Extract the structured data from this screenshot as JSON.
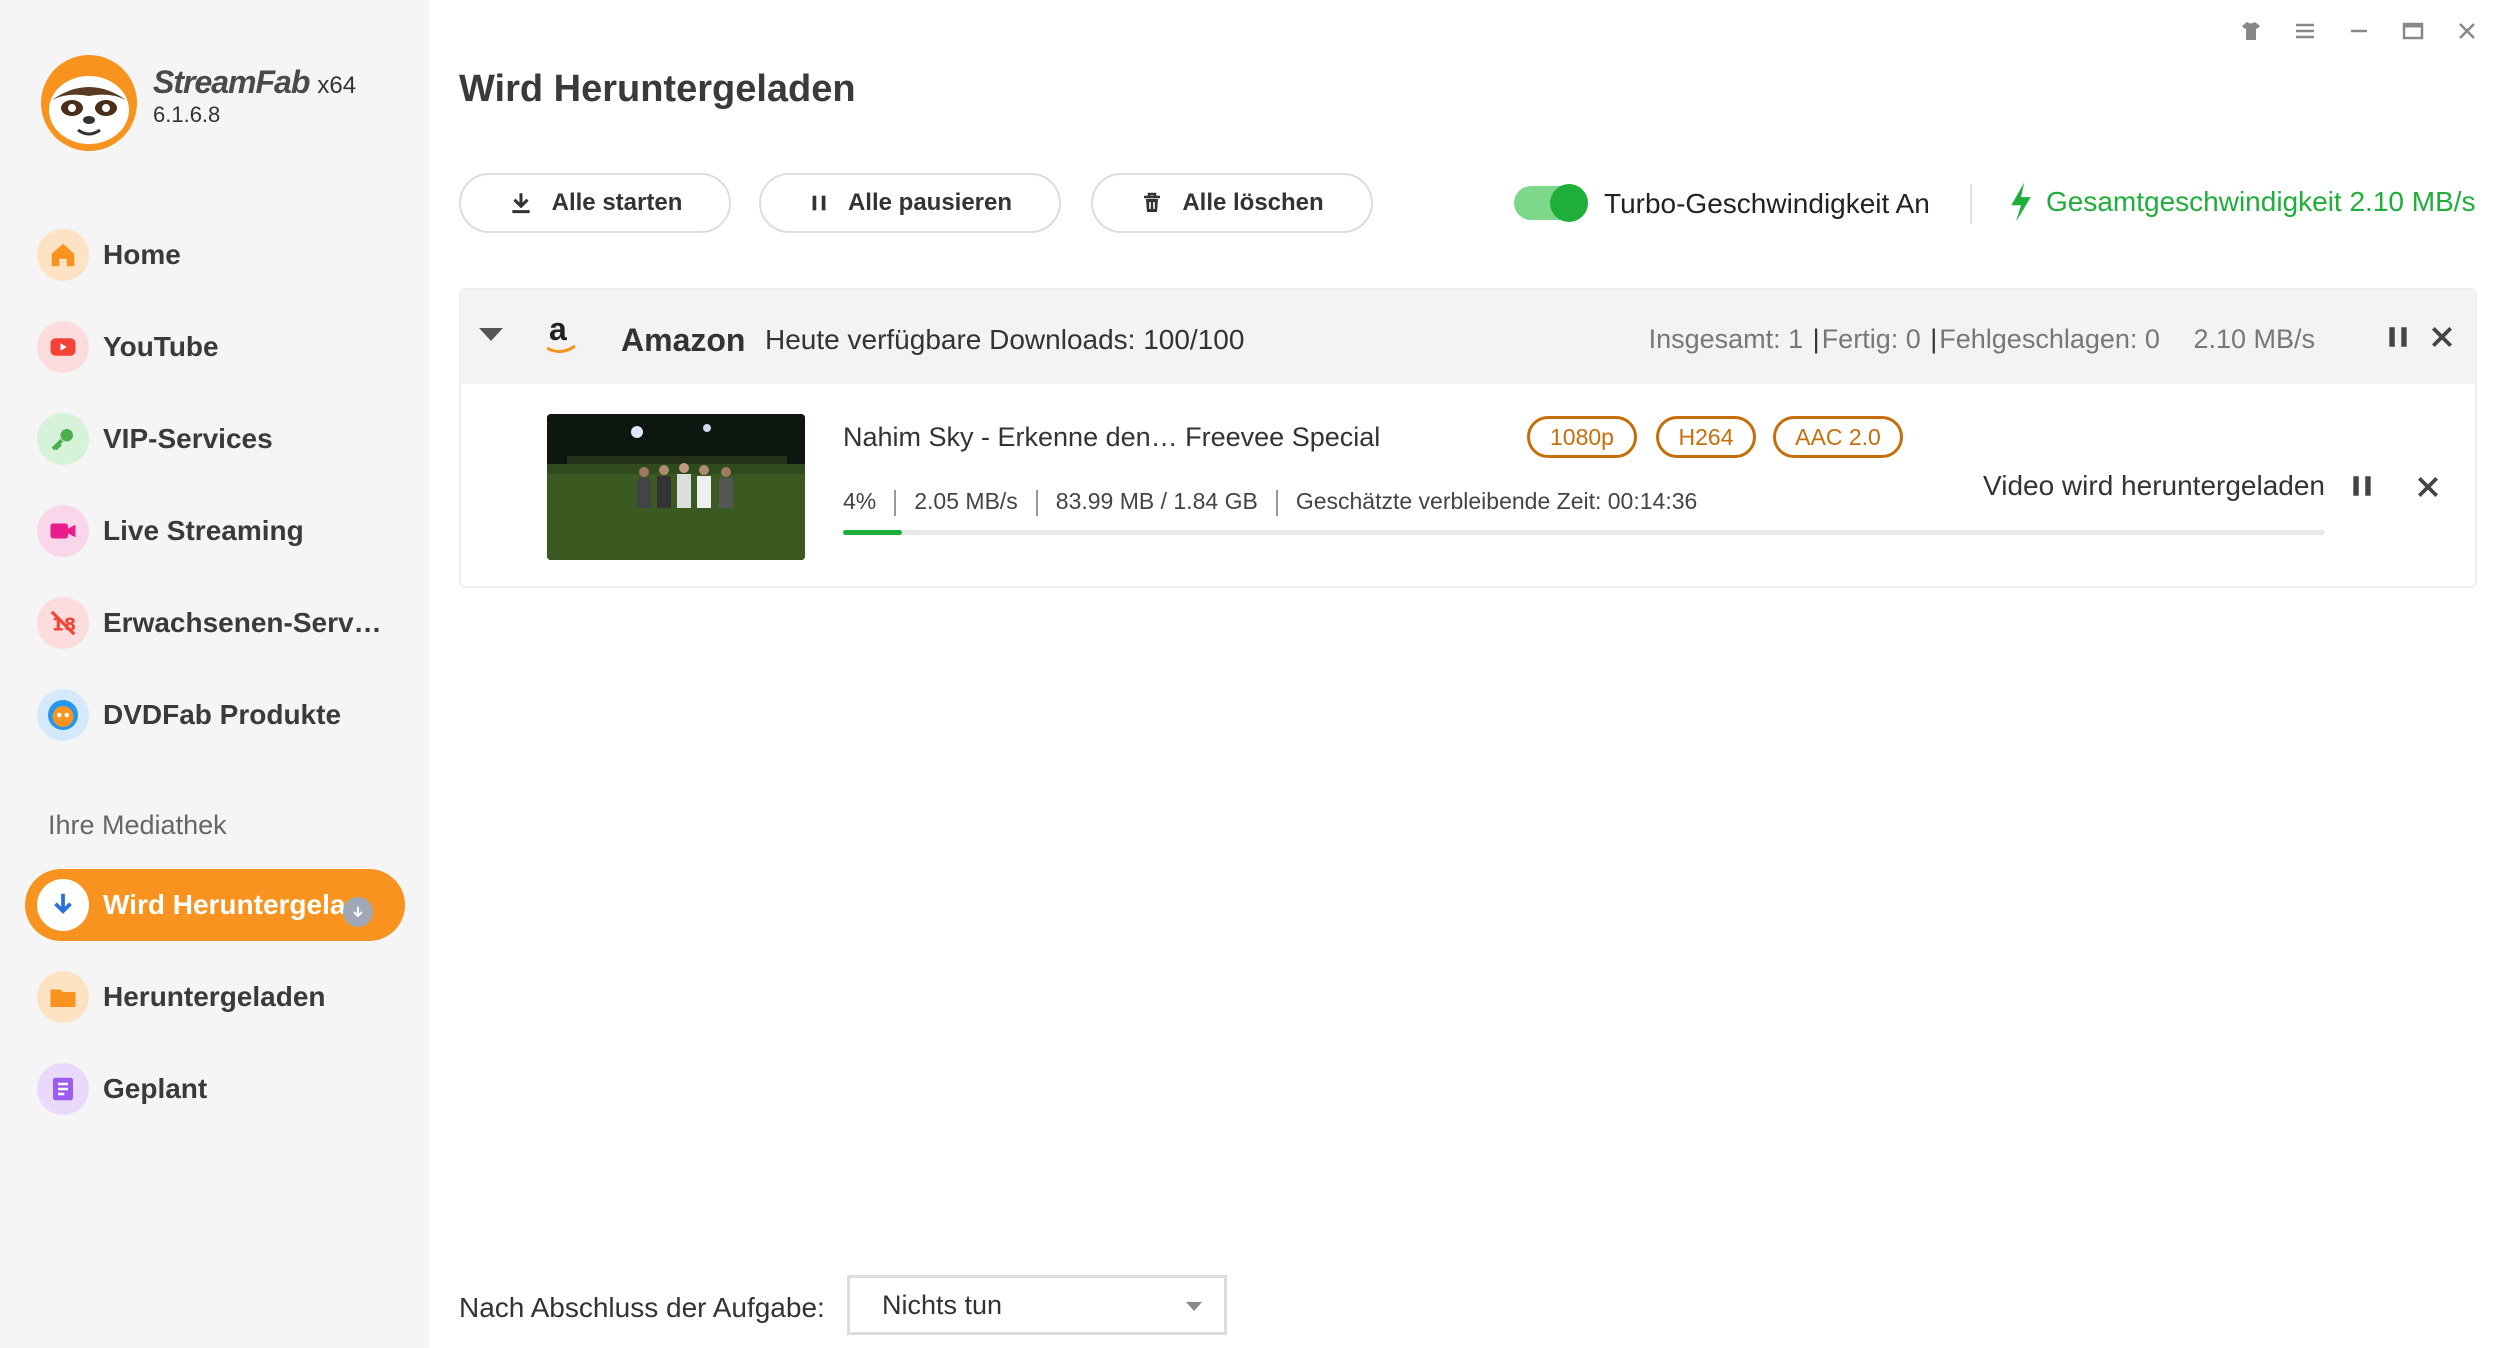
{
  "app": {
    "brand_name": "StreamFab",
    "arch": "x64",
    "version": "6.1.6.8"
  },
  "window_controls": [
    "shirt-icon",
    "menu-icon",
    "minimize-icon",
    "maximize-icon",
    "close-icon"
  ],
  "sidebar": {
    "items": [
      {
        "label": "Home",
        "icon": "home-icon",
        "color": "#f7931e"
      },
      {
        "label": "YouTube",
        "icon": "youtube-icon",
        "color": "#f44336"
      },
      {
        "label": "VIP-Services",
        "icon": "key-icon",
        "color": "#4caf50"
      },
      {
        "label": "Live Streaming",
        "icon": "camera-icon",
        "color": "#e91e8c"
      },
      {
        "label": "Erwachsenen-Serv…",
        "icon": "adult-icon",
        "color": "#f44336"
      },
      {
        "label": "DVDFab Produkte",
        "icon": "dvdfab-icon",
        "color": "#2196f3"
      }
    ],
    "library_label": "Ihre Mediathek",
    "library_items": [
      {
        "label": "Wird Heruntergela",
        "icon": "download-icon",
        "active": true
      },
      {
        "label": "Heruntergeladen",
        "icon": "folder-icon",
        "color": "#f7931e"
      },
      {
        "label": "Geplant",
        "icon": "calendar-icon",
        "color": "#9c5cf0"
      }
    ]
  },
  "main": {
    "title": "Wird Heruntergeladen",
    "toolbar": {
      "start_all": "Alle starten",
      "pause_all": "Alle pausieren",
      "delete_all": "Alle löschen"
    },
    "turbo_label": "Turbo-Geschwindigkeit An",
    "turbo_on": true,
    "total_speed": "Gesamtgeschwindigkeit 2.10 MB/s",
    "accent_color": "#f7931e",
    "success_color": "#1fae3a"
  },
  "group": {
    "service": "Amazon",
    "service_logo": "a",
    "available": "Heute verfügbare Downloads: 100/100",
    "total": "Insgesamt: 1",
    "done": "Fertig: 0",
    "failed": "Fehlgeschlagen: 0",
    "speed": "2.10 MB/s"
  },
  "item": {
    "title": "Nahim Sky - Erkenne den…  Freevee Special",
    "tags": [
      "1080p",
      "H264",
      "AAC 2.0"
    ],
    "percent": "4%",
    "speed": "2.05 MB/s",
    "size": "83.99 MB / 1.84 GB",
    "eta": "Geschätzte verbleibende Zeit: 00:14:36",
    "progress_fraction": 0.04,
    "status": "Video wird heruntergeladen"
  },
  "footer": {
    "label": "Nach Abschluss der Aufgabe:",
    "select_value": "Nichts tun"
  }
}
